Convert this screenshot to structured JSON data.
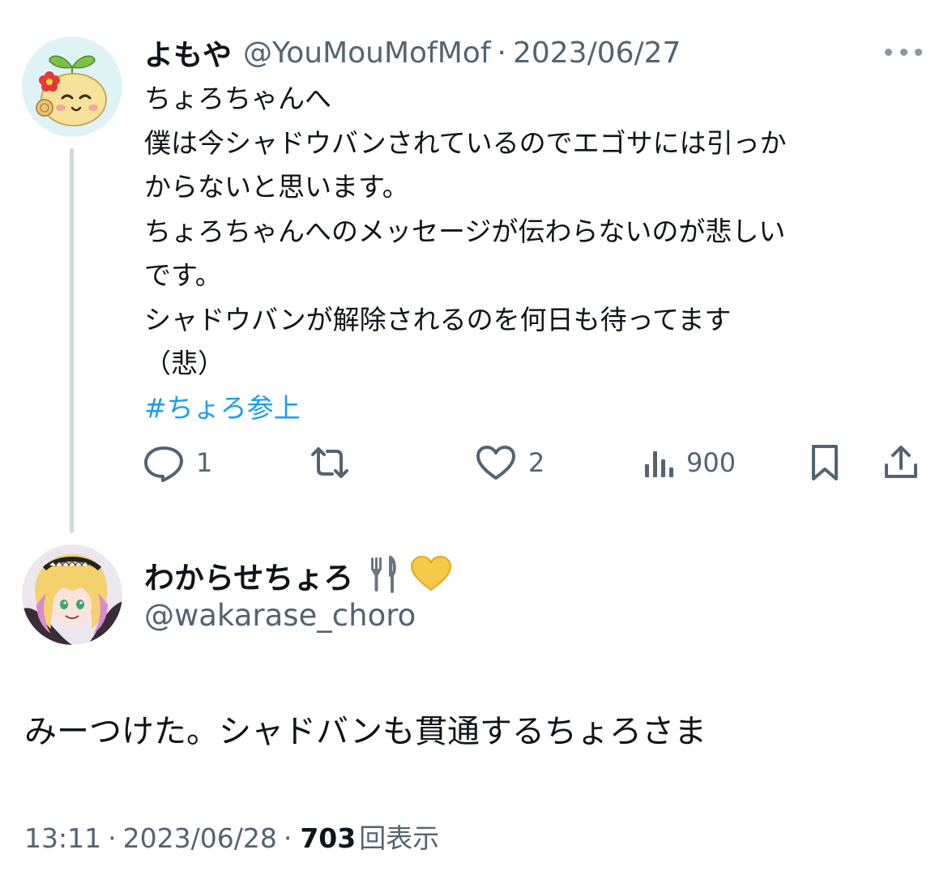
{
  "parent_tweet": {
    "display_name": "よもや",
    "handle": "@YouMouMofMof",
    "separator": "·",
    "date": "2023/06/27",
    "lines": [
      "ちょろちゃんへ",
      "僕は今シャドウバンされているのでエゴサには引っか",
      "からないと思います。",
      "ちょろちゃんへのメッセージが伝わらないのが悲しい",
      "です。",
      "シャドウバンが解除されるのを何日も待ってます",
      "（悲）"
    ],
    "hashtag": "#ちょろ参上",
    "actions": {
      "reply_count": "1",
      "retweet_count": "",
      "like_count": "2",
      "view_count": "900"
    },
    "icons": [
      "more-icon",
      "reply-icon",
      "retweet-icon",
      "like-icon",
      "views-icon",
      "bookmark-icon",
      "share-icon"
    ]
  },
  "reply_tweet": {
    "display_name": "わからせちょろ",
    "name_emojis": [
      "fork-and-knife-icon",
      "yellow-heart-icon"
    ],
    "handle": "@wakarase_choro",
    "text": "みーつけた。シャドバンも貫通するちょろさま",
    "time": "13:11",
    "separator": "·",
    "date": "2023/06/28",
    "views": "703",
    "views_label": "回表示"
  },
  "colors": {
    "text": "#0f1419",
    "secondary": "#536471",
    "link": "#1d9bf0",
    "thread_line": "#cfd9de"
  }
}
